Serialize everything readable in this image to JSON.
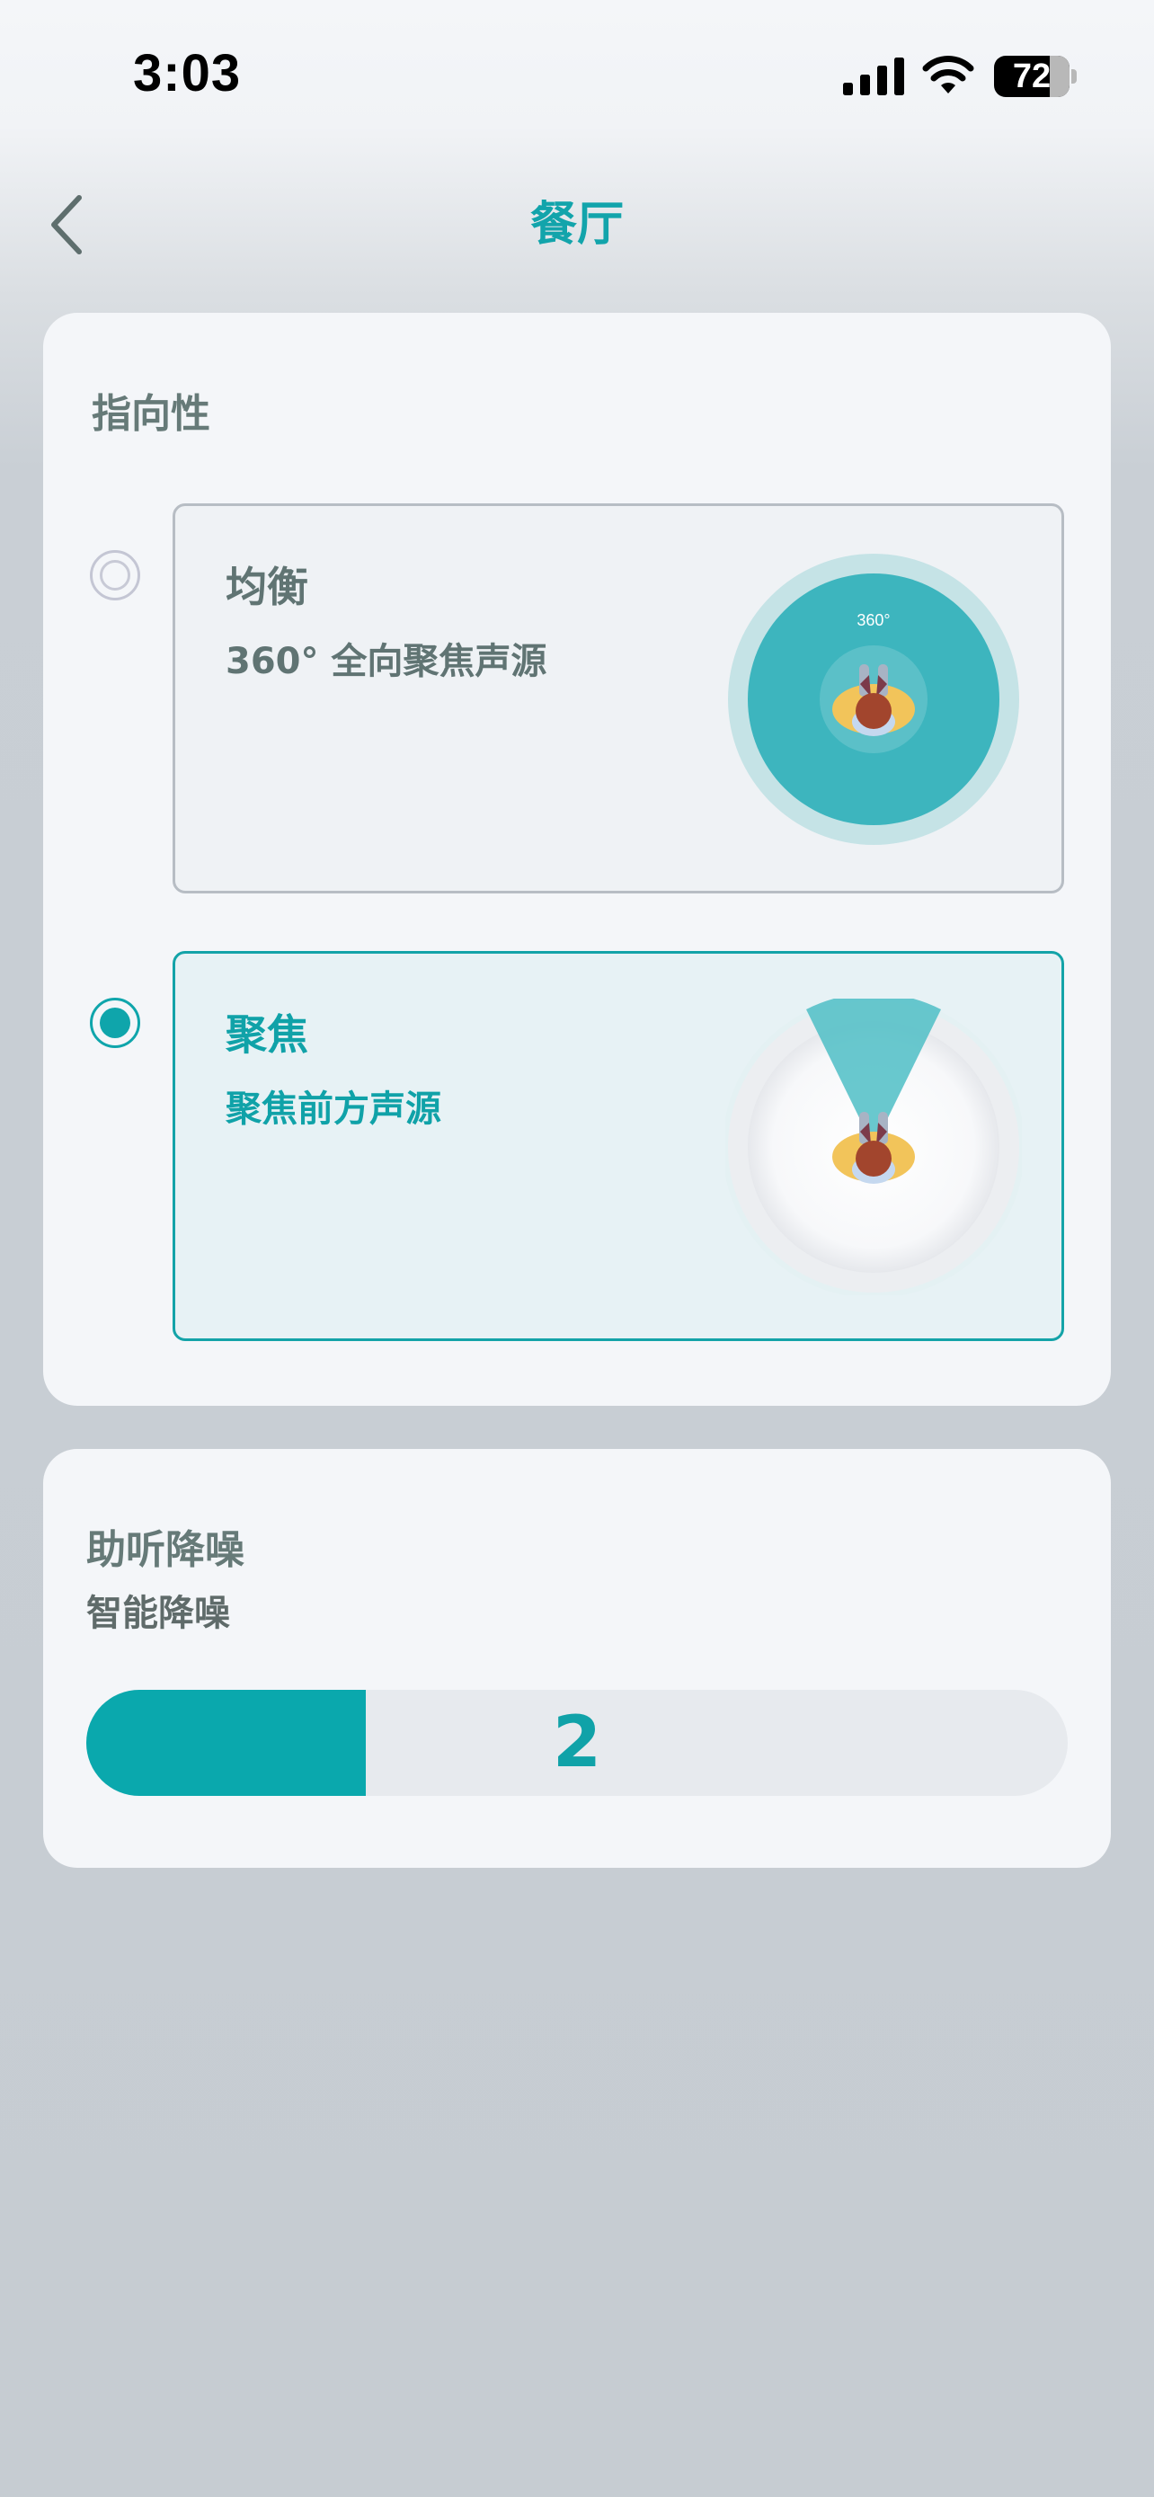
{
  "status_bar": {
    "time": "3:03",
    "battery": "72"
  },
  "nav": {
    "title": "餐厅",
    "back_icon": "chevron-left-icon"
  },
  "directivity": {
    "title": "指向性",
    "options": [
      {
        "title": "均衡",
        "subtitle": "360°  全向聚焦声源",
        "figure_label": "360°",
        "selected": false
      },
      {
        "title": "聚焦",
        "subtitle": "聚焦前方声源",
        "selected": true
      }
    ]
  },
  "noise_reduction": {
    "title": "助听降噪",
    "subtitle": "智能降噪",
    "level_label": "2",
    "level_fraction": 0.285
  },
  "colors": {
    "accent": "#0fa5ab",
    "text_muted": "#607473",
    "card_bg": "#f4f6f9"
  }
}
